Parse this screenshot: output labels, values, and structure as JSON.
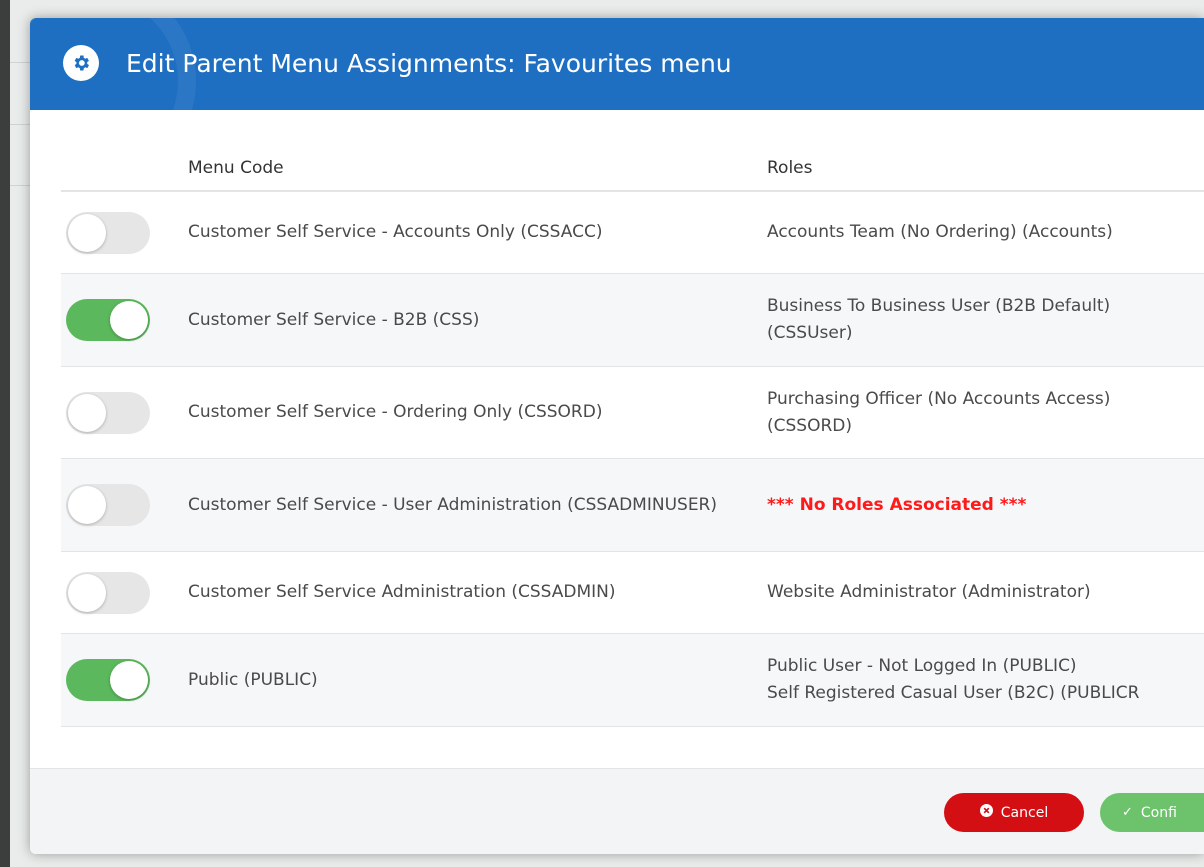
{
  "modal": {
    "title": "Edit Parent Menu Assignments: Favourites menu",
    "header_icon": "gear-icon",
    "header_color": "#1e6fc2"
  },
  "table": {
    "headers": {
      "code": "Menu Code",
      "roles": "Roles"
    },
    "rows": [
      {
        "enabled": false,
        "code": "Customer Self Service - Accounts Only (CSSACC)",
        "roles": [
          "Accounts Team (No Ordering) (Accounts)"
        ],
        "no_roles": false
      },
      {
        "enabled": true,
        "code": "Customer Self Service - B2B (CSS)",
        "roles": [
          "Business To Business User (B2B Default)",
          "(CSSUser)"
        ],
        "no_roles": false
      },
      {
        "enabled": false,
        "code": "Customer Self Service - Ordering Only (CSSORD)",
        "roles": [
          "Purchasing Officer (No Accounts Access)",
          "(CSSORD)"
        ],
        "no_roles": false
      },
      {
        "enabled": false,
        "code": "Customer Self Service - User Administration (CSSADMINUSER)",
        "roles": [
          "*** No Roles Associated ***"
        ],
        "no_roles": true
      },
      {
        "enabled": false,
        "code": "Customer Self Service Administration (CSSADMIN)",
        "roles": [
          "Website Administrator (Administrator)"
        ],
        "no_roles": false
      },
      {
        "enabled": true,
        "code": "Public (PUBLIC)",
        "roles": [
          "Public User - Not Logged In (PUBLIC)",
          "Self Registered Casual User (B2C) (PUBLICR"
        ],
        "no_roles": false
      }
    ]
  },
  "footer": {
    "cancel_label": "Cancel",
    "cancel_icon": "times-circle-icon",
    "confirm_label": "Confi",
    "confirm_icon": "check-icon"
  },
  "colors": {
    "toggle_on": "#5cb85c",
    "toggle_off": "#e6e6e6",
    "cancel": "#d40f14",
    "confirm": "#6cc36c",
    "no_roles": "#ff1a1a"
  }
}
